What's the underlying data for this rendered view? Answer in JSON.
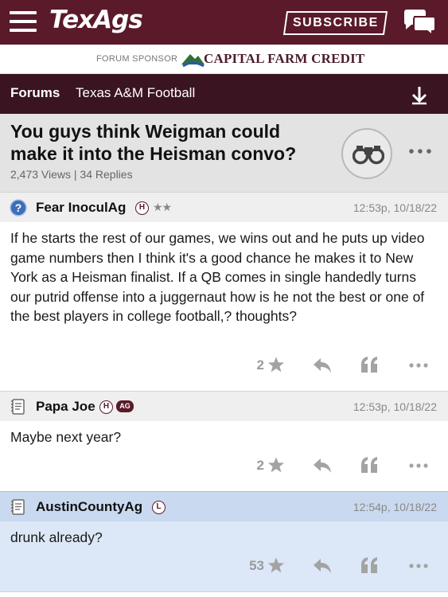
{
  "header": {
    "logo": "TexAgs",
    "subscribe_label": "SUBSCRIBE"
  },
  "sponsor": {
    "label": "FORUM SPONSOR",
    "name": "CAPITAL FARM CREDIT"
  },
  "breadcrumb": {
    "forums": "Forums",
    "board": "Texas A&M Football"
  },
  "thread": {
    "title": "You guys think Weigman could make it into the Heisman convo?",
    "stats": "2,473 Views | 34 Replies"
  },
  "posts": [
    {
      "username": "Fear InoculAg",
      "badge": "H",
      "rank_stars": "★★",
      "timestamp": "12:53p, 10/18/22",
      "body": "If he starts the rest of our games, we wins out and he puts up video game numbers then I think it's a good chance he makes it to New York as a Heisman finalist. If a QB comes in single handedly turns our putrid offense into a juggernaut how is he not the best or one of the best players in college football,? thoughts?",
      "stars": "2"
    },
    {
      "username": "Papa Joe",
      "badge": "H",
      "badge2": "AG",
      "timestamp": "12:53p, 10/18/22",
      "body": "Maybe next year?",
      "stars": "2"
    },
    {
      "username": "AustinCountyAg",
      "badge": "L",
      "timestamp": "12:54p, 10/18/22",
      "body": "drunk already?",
      "stars": "53"
    }
  ],
  "colors": {
    "brand_maroon": "#5a1a2a",
    "breadcrumb_bg": "#3a1420",
    "highlight_post": "#dce8f7"
  }
}
